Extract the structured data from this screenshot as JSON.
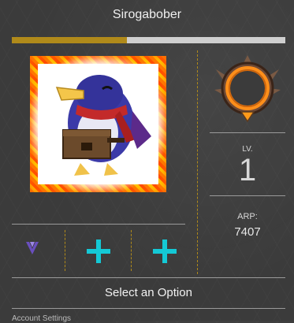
{
  "profile": {
    "username": "Sirogabober",
    "level_progress": 0.42,
    "level_label": "LV.",
    "level_value": "1",
    "arp_label": "ARP:",
    "arp_value": "7407"
  },
  "colors": {
    "accent_gold": "#b08a1a",
    "add_icon": "#14c9d6",
    "badge_purple": "#6a4fbf"
  },
  "slots": [
    {
      "icon": "purple-chevron-badge-icon"
    },
    {
      "icon": "add-icon"
    },
    {
      "icon": "add-icon"
    }
  ],
  "menu": {
    "select_option_label": "Select an Option",
    "next_item_label": "Account Settings"
  }
}
